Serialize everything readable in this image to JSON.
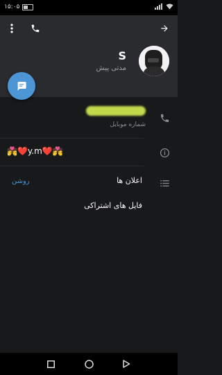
{
  "status_bar": {
    "time": "۱۵:۰۵"
  },
  "profile": {
    "name": "S",
    "last_seen": "مدتی پیش"
  },
  "info": {
    "phone_label": "شماره موبایل",
    "bio": "💏❤️y.m❤️💏"
  },
  "settings": {
    "notifications_label": "اعلان ها",
    "notifications_value": "روشن",
    "shared_files_label": "فایل های اشتراکی"
  },
  "icons": {
    "more": "more-vertical-icon",
    "call": "phone-icon",
    "back": "arrow-right-icon",
    "message": "chat-icon",
    "phone_row": "phone-icon",
    "info_row": "info-icon",
    "settings_row": "list-icon"
  },
  "colors": {
    "accent": "#4c96d5",
    "header_bg": "#2a2b2e",
    "body_bg": "#18191b"
  }
}
